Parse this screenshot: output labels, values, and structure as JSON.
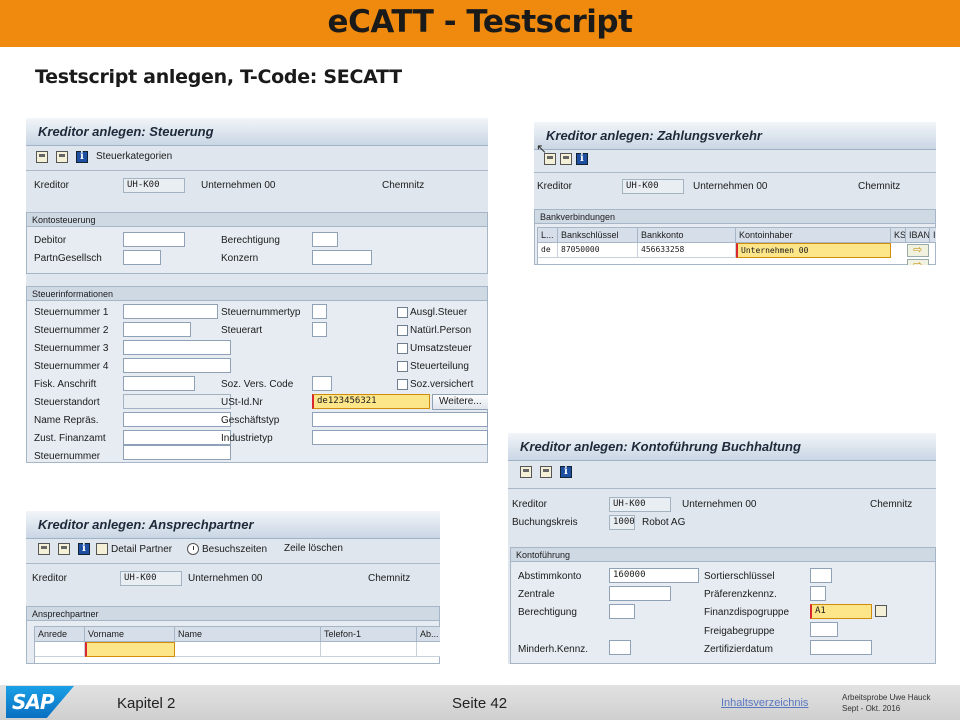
{
  "slide": {
    "title": "eCATT - Testscript",
    "subtitle": "Testscript anlegen, T-Code: SECATT"
  },
  "steuerung": {
    "title": "Kreditor anlegen: Steuerung",
    "toolbar_item": "Steuerkategorien",
    "kreditor_label": "Kreditor",
    "kreditor_value": "UH-K00",
    "company": "Unternehmen 00",
    "city": "Chemnitz",
    "group1_title": "Kontosteuerung",
    "debitor": "Debitor",
    "berechtigung": "Berechtigung",
    "partn": "PartnGesellsch",
    "konzern": "Konzern",
    "group2_title": "Steuerinformationen",
    "stnr1": "Steuernummer 1",
    "stnr2": "Steuernummer 2",
    "stnr3": "Steuernummer 3",
    "stnr4": "Steuernummer 4",
    "fisk": "Fisk. Anschrift",
    "standort": "Steuerstandort",
    "name_repr": "Name Repräs.",
    "zust": "Zust. Finanzamt",
    "stnr": "Steuernummer",
    "stnrtyp": "Steuernummertyp",
    "steuerart": "Steuerart",
    "sozvers": "Soz. Vers. Code",
    "ustid": "USt-Id.Nr",
    "ustid_value": "de123456321",
    "geschaeftstyp": "Geschäftstyp",
    "industrietyp": "Industrietyp",
    "cb_ausgl": "Ausgl.Steuer",
    "cb_natuerl": "Natürl.Person",
    "cb_umsatz": "Umsatzsteuer",
    "cb_teilung": "Steuerteilung",
    "cb_sozvers": "Soz.versichert",
    "weitere": "Weitere..."
  },
  "zahlung": {
    "title": "Kreditor anlegen: Zahlungsverkehr",
    "kreditor_label": "Kreditor",
    "kreditor_value": "UH-K00",
    "company": "Unternehmen 00",
    "city": "Chemnitz",
    "group_title": "Bankverbindungen",
    "columns": [
      "L...",
      "Bankschlüssel",
      "Bankkonto",
      "Kontoinhaber",
      "KS",
      "IBAN",
      "I"
    ],
    "row": [
      "de",
      "87050000",
      "456633258",
      "Unternehmen 00"
    ]
  },
  "ansprech": {
    "title": "Kreditor anlegen: Ansprechpartner",
    "tb_detail": "Detail Partner",
    "tb_besuch": "Besuchszeiten",
    "tb_loeschen": "Zeile löschen",
    "kreditor_label": "Kreditor",
    "kreditor_value": "UH-K00",
    "company": "Unternehmen 00",
    "city": "Chemnitz",
    "group_title": "Ansprechpartner",
    "columns": [
      "Anrede",
      "Vorname",
      "Name",
      "Telefon-1",
      "Ab..."
    ]
  },
  "konto": {
    "title": "Kreditor anlegen: Kontoführung Buchhaltung",
    "kreditor_label": "Kreditor",
    "kreditor_value": "UH-K00",
    "company": "Unternehmen 00",
    "city": "Chemnitz",
    "bukrs_label": "Buchungskreis",
    "bukrs_value": "1000",
    "bukrs_name": "Robot AG",
    "group_title": "Kontoführung",
    "abstimm": "Abstimmkonto",
    "abstimm_value": "160000",
    "zentrale": "Zentrale",
    "berechtigung": "Berechtigung",
    "minderh": "Minderh.Kennz.",
    "sortier": "Sortierschlüssel",
    "praeferenz": "Präferenzkennz.",
    "finanz": "Finanzdispogruppe",
    "finanz_value": "A1",
    "freigabe": "Freigabegruppe",
    "zertifiziert": "Zertifizierdatum"
  },
  "footer": {
    "kapitel": "Kapitel 2",
    "seite": "Seite 42",
    "link": "Inhaltsverzeichnis",
    "note_line1": "Arbeitsprobe Uwe Hauck",
    "note_line2": "Sept - Okt. 2016",
    "logo": "SAP"
  },
  "colors": {
    "title_bar": "#f08a0e",
    "highlight_field": "#fde68a",
    "sap_blue": "#0a6fc0"
  }
}
